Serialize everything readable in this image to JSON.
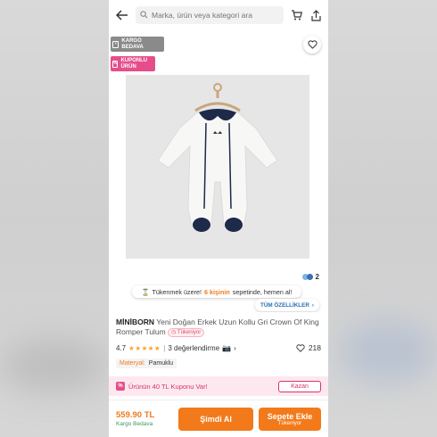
{
  "topbar": {
    "search_placeholder": "Marka, ürün veya kategori ara"
  },
  "badges": {
    "cargo": "KARGO BEDAVA",
    "coupon": "KUPONLU ÜRÜN"
  },
  "favorites": {
    "count": "2"
  },
  "stock_notice": {
    "prefix": "Tükenmek üzere!",
    "highlight": "6 kişinin",
    "suffix": "sepetinde, hemen al!"
  },
  "all_specs_label": "TÜM ÖZELLİKLER",
  "product": {
    "brand": "MİNİBORN",
    "title": "Yeni Doğan Erkek Uzun Kollu Gri Crown Of King Romper Tulum",
    "sold_tag": "Tükeniyor",
    "rating": "4.7",
    "stars": "★★★★★",
    "reviews": "3 değerlendirme",
    "likes": "218",
    "material_label": "Materyal:",
    "material_value": "Pamuklu"
  },
  "coupon": {
    "text": "Ürünün 40 TL Kuponu Var!",
    "action": "Kazan"
  },
  "bottom": {
    "price": "559.90 TL",
    "cargo_note": "Kargo Bedava",
    "buy_now": "Şimdi Al",
    "add_cart": "Sepete Ekle",
    "add_cart_sub": "Tükeniyor"
  },
  "colors": {
    "accent": "#f27a1a",
    "coupon_pink": "#e64d8a",
    "navy": "#1e2a4a"
  },
  "icons": [
    "back-arrow-icon",
    "search-icon",
    "cart-icon",
    "share-icon",
    "heart-icon",
    "truck-icon",
    "ticket-icon",
    "chevron-right-icon",
    "camera-icon",
    "percent-icon"
  ]
}
